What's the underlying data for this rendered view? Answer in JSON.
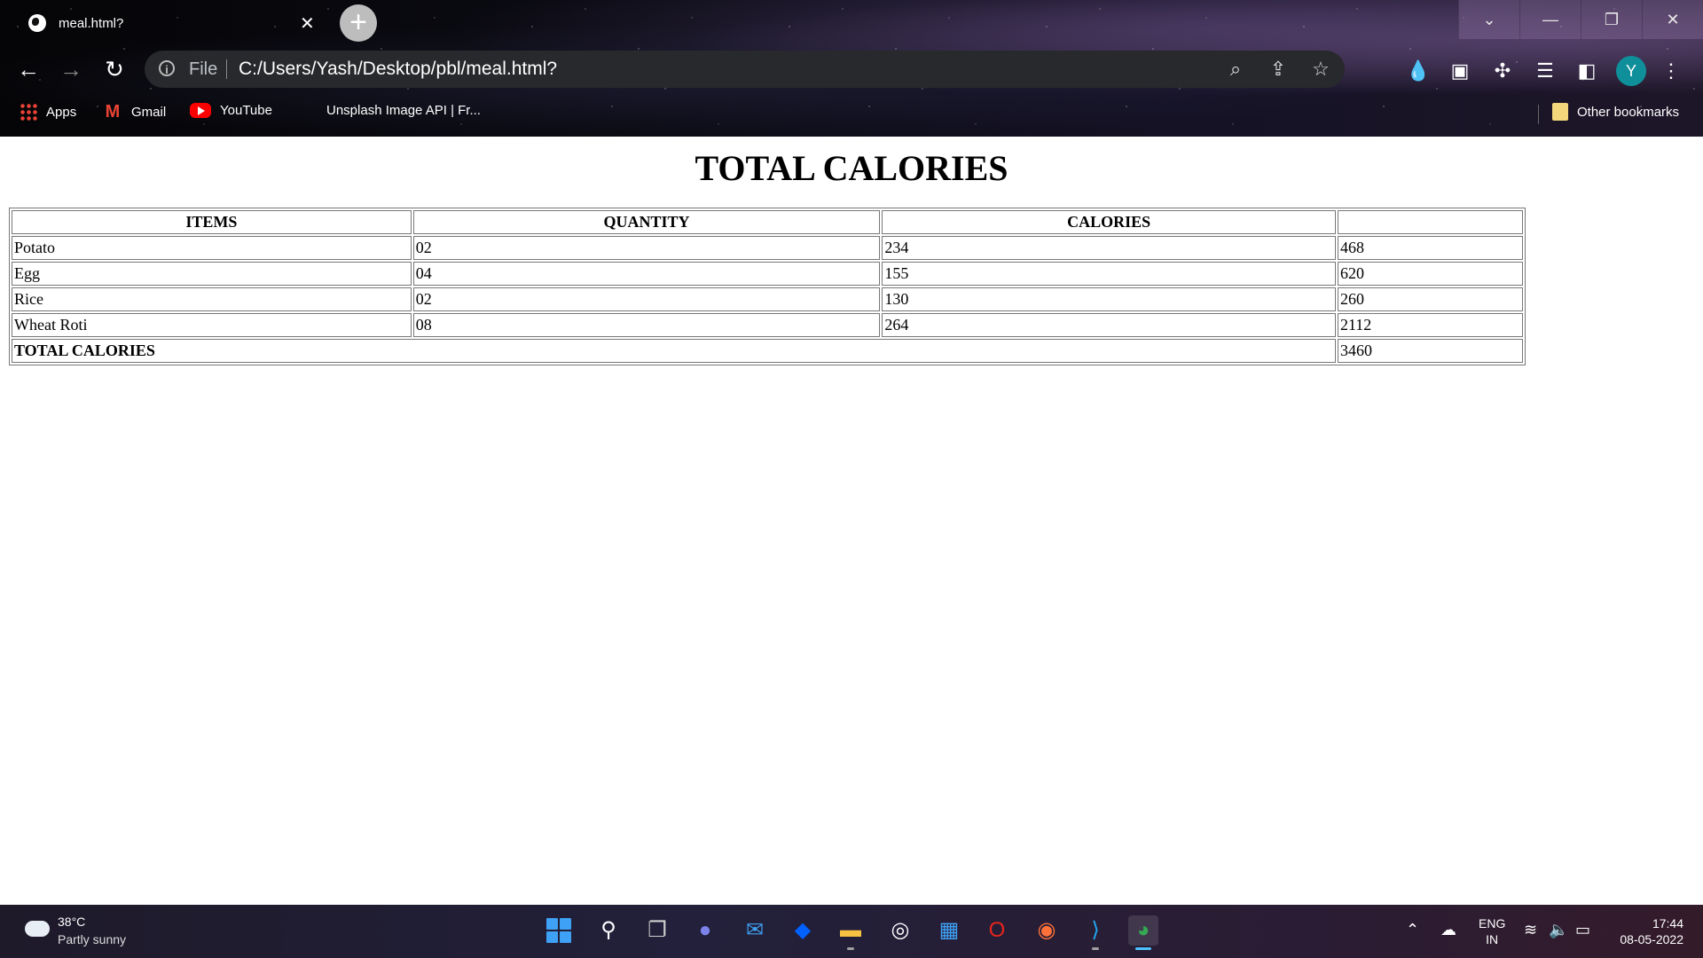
{
  "browser": {
    "tab_title": "meal.html?",
    "omnibox_scheme": "File",
    "url": "C:/Users/Yash/Desktop/pbl/meal.html?",
    "bookmarks": [
      {
        "label": "Apps"
      },
      {
        "label": "Gmail"
      },
      {
        "label": "YouTube"
      },
      {
        "label": "Unsplash Image API | Fr..."
      }
    ],
    "other_bookmarks": "Other bookmarks",
    "avatar_initial": "Y"
  },
  "page": {
    "title": "TOTAL CALORIES",
    "table": {
      "headers": [
        "ITEMS",
        "QUANTITY",
        "CALORIES",
        ""
      ],
      "rows": [
        [
          "Potato",
          "02",
          "234",
          "468"
        ],
        [
          "Egg",
          "04",
          "155",
          "620"
        ],
        [
          "Rice",
          "02",
          "130",
          "260"
        ],
        [
          "Wheat Roti",
          "08",
          "264",
          "2112"
        ]
      ],
      "total_label": "TOTAL CALORIES",
      "total_value": "3460"
    }
  },
  "taskbar": {
    "weather_temp": "38°C",
    "weather_desc": "Partly sunny",
    "language_line1": "ENG",
    "language_line2": "IN",
    "time": "17:44",
    "date": "08-05-2022",
    "pinned_apps": [
      "start-menu",
      "search",
      "task-view",
      "teams-chat",
      "mail",
      "dropbox",
      "file-explorer",
      "app",
      "store",
      "opera",
      "firefox",
      "vscode",
      "chrome"
    ]
  },
  "colors": {
    "omnibox_bg": "#28292c",
    "avatar_bg": "#0f8f9a",
    "youtube_red": "#ff0000",
    "windows_blue": "#3fa1f5"
  }
}
